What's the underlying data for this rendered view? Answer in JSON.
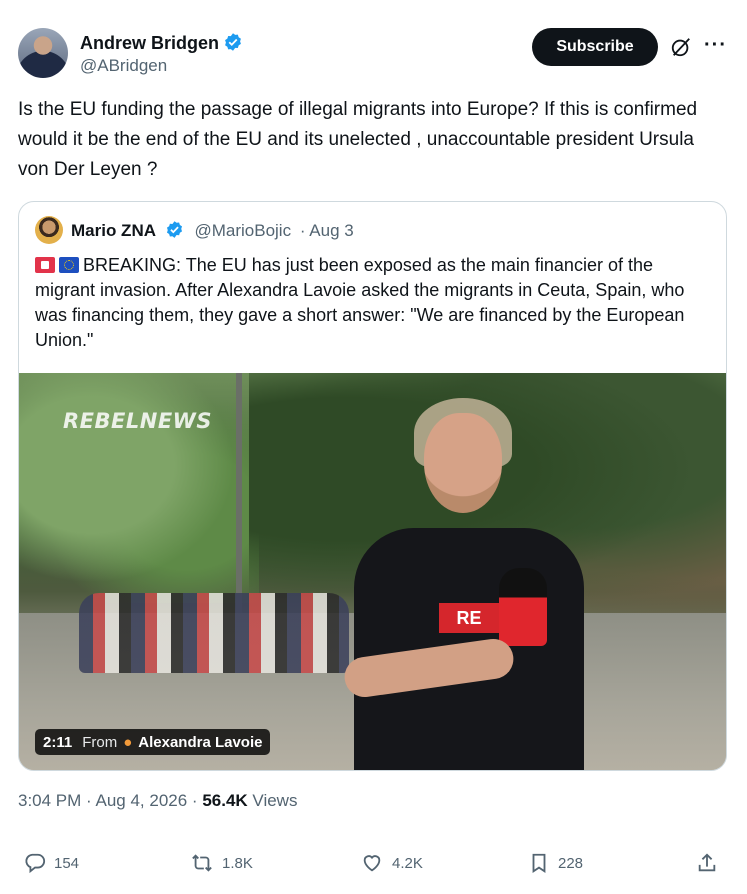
{
  "author": {
    "name": "Andrew Bridgen",
    "handle": "@ABridgen",
    "subscribe_label": "Subscribe",
    "more_label": "···"
  },
  "tweet_text": "Is the EU funding the passage of illegal migrants into Europe? If this is confirmed would it be the end of the EU and its unelected , unaccountable president Ursula von Der Leyen ?",
  "quote": {
    "name": "Mario ZNA",
    "handle": "@MarioBojic",
    "date": "· Aug 3",
    "text": "BREAKING: The EU has just been exposed as the main financier of the migrant invasion. After Alexandra Lavoie asked the migrants in Ceuta, Spain, who was financing them, they gave a short answer: \"We are financed by the European Union.\"",
    "media": {
      "watermark": "REBELNEWS",
      "duration": "2:11",
      "from_label": "From",
      "source": "Alexandra Lavoie",
      "shirt_text": "RE"
    }
  },
  "meta": {
    "time": "3:04 PM",
    "date": "· Aug 4, 2026 ·",
    "views_count": "56.4K",
    "views_label": "Views"
  },
  "actions": {
    "replies": "154",
    "reposts": "1.8K",
    "likes": "4.2K",
    "bookmarks": "228"
  },
  "colors": {
    "verified": "#1d9bf0",
    "text": "#0f1419",
    "secondary": "#536471",
    "border": "#cfd9de"
  }
}
